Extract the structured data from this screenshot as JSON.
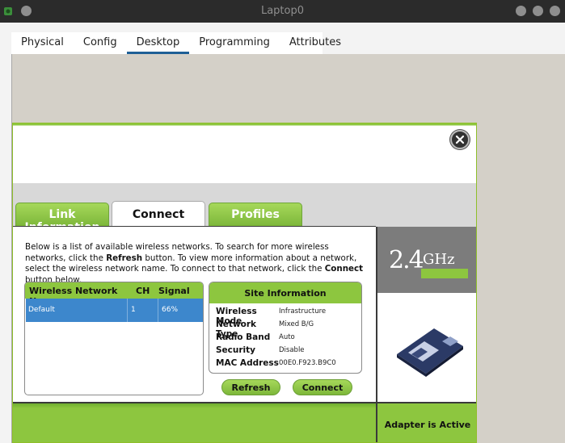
{
  "window": {
    "title": "Laptop0"
  },
  "tabs": [
    {
      "label": "Physical"
    },
    {
      "label": "Config"
    },
    {
      "label": "Desktop"
    },
    {
      "label": "Programming"
    },
    {
      "label": "Attributes"
    }
  ],
  "active_tab": "Desktop",
  "linksys": {
    "tabs": [
      {
        "label": "Link Information"
      },
      {
        "label": "Connect"
      },
      {
        "label": "Profiles"
      }
    ],
    "active_tab": "Connect",
    "description": {
      "p1": "Below is a list of available wireless networks. To search for more wireless networks, click the ",
      "refresh_word": "Refresh",
      "p2": " button. To view more information about a network, select the wireless network name. To connect to that network, click the ",
      "connect_word": "Connect",
      "p3": " button below."
    },
    "network_list": {
      "headers": [
        "Wireless Network Name",
        "CH",
        "Signal"
      ],
      "rows": [
        {
          "name": "Default",
          "ch": "1",
          "signal": "66%",
          "selected": true
        }
      ]
    },
    "site_info": {
      "title": "Site Information",
      "fields": [
        {
          "label": "Wireless Mode",
          "value": "Infrastructure"
        },
        {
          "label": "Network Type",
          "value": "Mixed B/G"
        },
        {
          "label": "Radio Band",
          "value": "Auto"
        },
        {
          "label": "Security",
          "value": "Disable"
        },
        {
          "label": "MAC Address",
          "value": "00E0.F923.B9C0"
        }
      ]
    },
    "buttons": {
      "refresh": "Refresh",
      "connect": "Connect"
    },
    "badge": {
      "number": "2.4",
      "unit": "GHz"
    },
    "status": "Adapter is Active",
    "colors": {
      "accent_green": "#8dc63f",
      "selection_blue": "#3d87cc"
    },
    "icons": [
      "close-icon",
      "wireless-card-icon"
    ]
  }
}
